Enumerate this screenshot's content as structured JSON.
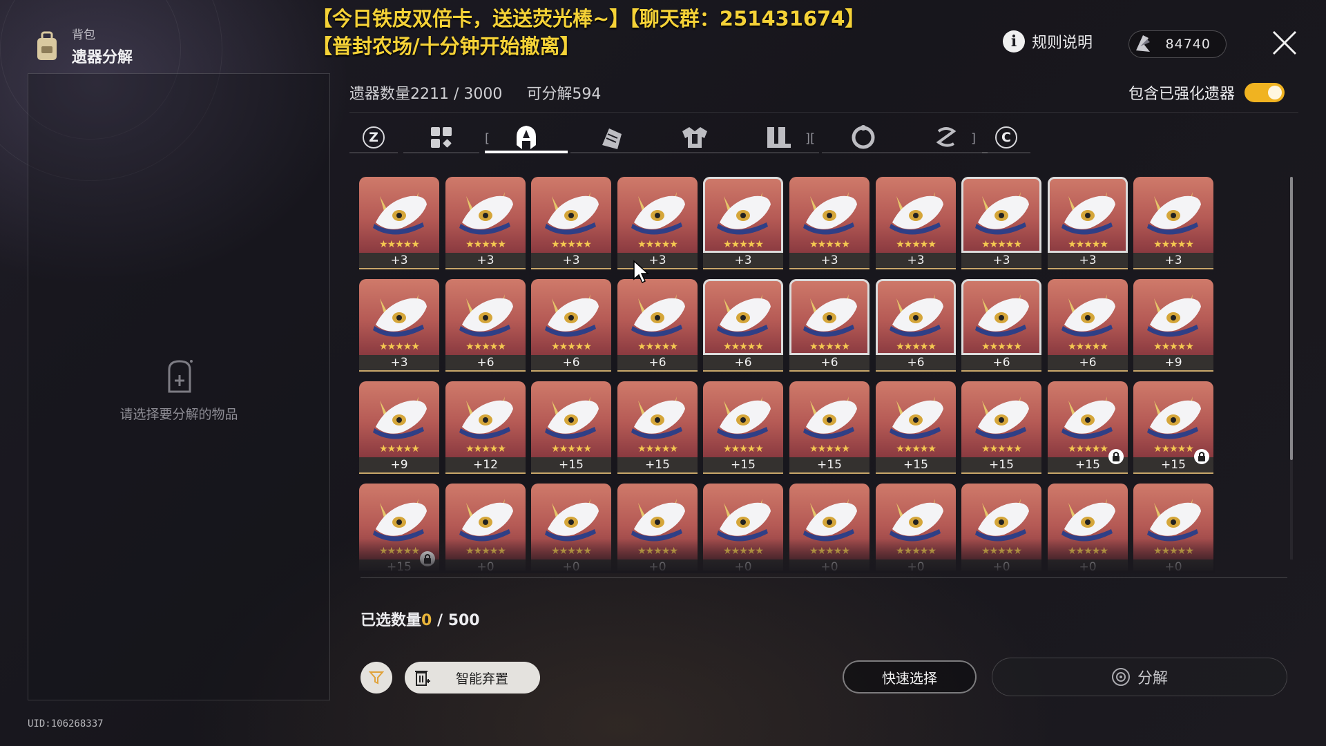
{
  "header": {
    "category": "背包",
    "title": "遗器分解",
    "banner_line1": "【今日铁皮双倍卡，送送荧光棒~】【聊天群：251431674】",
    "banner_line2": "【普封农场/十分钟开始撤离】",
    "rules_label": "规则说明",
    "currency_value": "84740"
  },
  "left_panel": {
    "empty_text": "请选择要分解的物品",
    "uid": "UID:106268337"
  },
  "inventory": {
    "count_label": "遗器数量2211 / 3000",
    "decomposable_label": "可分解594",
    "toggle_label": "包含已强化遗器",
    "toggle_on": true
  },
  "tabs": [
    {
      "name": "key-z",
      "label": "Z"
    },
    {
      "name": "all",
      "icon": "grid-icon"
    },
    {
      "name": "head",
      "icon": "helmet-icon",
      "active": true
    },
    {
      "name": "hands",
      "icon": "glove-icon"
    },
    {
      "name": "body",
      "icon": "armor-icon"
    },
    {
      "name": "feet",
      "icon": "boots-icon"
    },
    {
      "name": "sphere",
      "icon": "ring-icon"
    },
    {
      "name": "rope",
      "icon": "rope-icon"
    },
    {
      "name": "key-c",
      "label": "C"
    }
  ],
  "items": [
    {
      "level": "+3"
    },
    {
      "level": "+3"
    },
    {
      "level": "+3"
    },
    {
      "level": "+3"
    },
    {
      "level": "+3",
      "selected": true
    },
    {
      "level": "+3"
    },
    {
      "level": "+3"
    },
    {
      "level": "+3",
      "selected": true
    },
    {
      "level": "+3",
      "selected": true
    },
    {
      "level": "+3"
    },
    {
      "level": "+3"
    },
    {
      "level": "+6"
    },
    {
      "level": "+6"
    },
    {
      "level": "+6"
    },
    {
      "level": "+6",
      "selected": true
    },
    {
      "level": "+6",
      "selected": true
    },
    {
      "level": "+6",
      "selected": true
    },
    {
      "level": "+6",
      "selected": true
    },
    {
      "level": "+6"
    },
    {
      "level": "+9"
    },
    {
      "level": "+9"
    },
    {
      "level": "+12"
    },
    {
      "level": "+15"
    },
    {
      "level": "+15"
    },
    {
      "level": "+15"
    },
    {
      "level": "+15"
    },
    {
      "level": "+15"
    },
    {
      "level": "+15"
    },
    {
      "level": "+15",
      "locked": true
    },
    {
      "level": "+15",
      "locked": true
    },
    {
      "level": "+15",
      "locked": true
    },
    {
      "level": "+0"
    },
    {
      "level": "+0"
    },
    {
      "level": "+0"
    },
    {
      "level": "+0"
    },
    {
      "level": "+0"
    },
    {
      "level": "+0"
    },
    {
      "level": "+0"
    },
    {
      "level": "+0"
    },
    {
      "level": "+0"
    }
  ],
  "item_stars": "★★★★★",
  "footer": {
    "selected_label": "已选数量",
    "selected_count": "0",
    "selected_max": "/ 500",
    "smart_discard_label": "智能弃置",
    "quick_select_label": "快速选择",
    "decompose_label": "分解"
  },
  "colors": {
    "accent": "#f0b321",
    "banner": "#f5d237",
    "card_top": "#cf7a6a",
    "card_bottom": "#8a3a40"
  }
}
